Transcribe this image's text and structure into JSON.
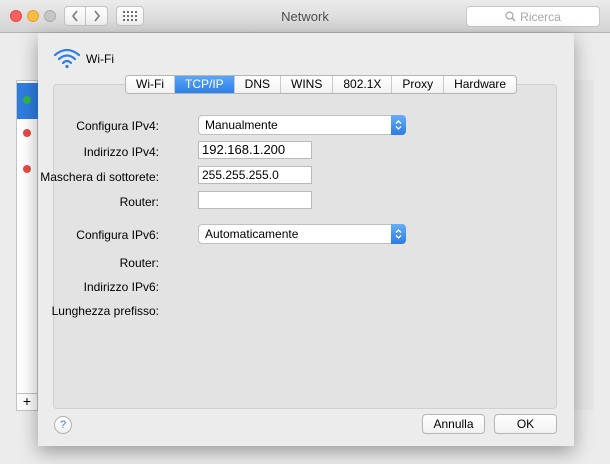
{
  "window": {
    "title": "Network",
    "search_placeholder": "Ricerca"
  },
  "toolbar": {
    "back_icon": "chevron-left-icon",
    "forward_icon": "chevron-right-icon",
    "grid_icon": "grid-icon",
    "search_icon": "search-icon"
  },
  "sidebar": {
    "add_label": "+",
    "status_colors": [
      "#2fb64a",
      "#e94b46",
      "#e94b46"
    ]
  },
  "sheet": {
    "interface_title": "Wi-Fi",
    "tabs": [
      {
        "label": "Wi-Fi",
        "active": false
      },
      {
        "label": "TCP/IP",
        "active": true
      },
      {
        "label": "DNS",
        "active": false
      },
      {
        "label": "WINS",
        "active": false
      },
      {
        "label": "802.1X",
        "active": false
      },
      {
        "label": "Proxy",
        "active": false
      },
      {
        "label": "Hardware",
        "active": false
      }
    ],
    "ipv4": {
      "configure_label": "Configura IPv4:",
      "configure_value": "Manualmente",
      "address_label": "Indirizzo IPv4:",
      "address_value": "192.168.1.200",
      "subnet_label": "Maschera di sottorete:",
      "subnet_value": "255.255.255.0",
      "router_label": "Router:",
      "router_value": ""
    },
    "ipv6": {
      "configure_label": "Configura IPv6:",
      "configure_value": "Automaticamente",
      "router_label": "Router:",
      "address_label": "Indirizzo IPv6:",
      "prefix_label": "Lunghezza prefisso:"
    },
    "help_label": "?",
    "cancel_label": "Annulla",
    "ok_label": "OK"
  },
  "colors": {
    "accent": "#2f7fe5"
  }
}
